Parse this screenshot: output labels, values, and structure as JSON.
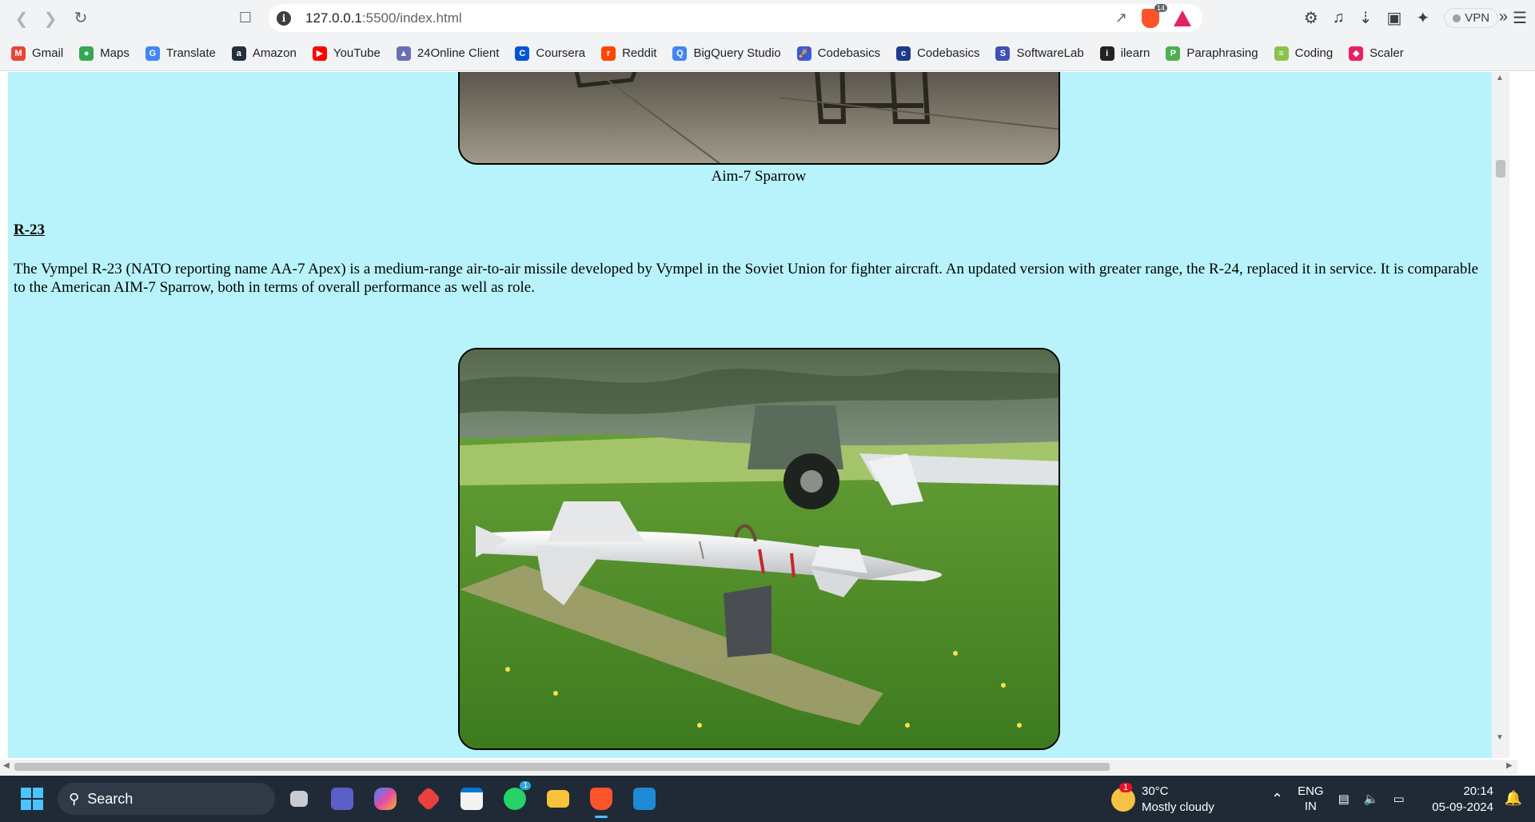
{
  "browser": {
    "url_host": "127.0.0.1",
    "url_path": ":5500/index.html",
    "shield_badge": "14",
    "vpn_label": "VPN"
  },
  "bookmarks": [
    {
      "label": "Gmail",
      "color": "#ea4335",
      "icon": "M"
    },
    {
      "label": "Maps",
      "color": "#34a853",
      "icon": "●"
    },
    {
      "label": "Translate",
      "color": "#4285f4",
      "icon": "G"
    },
    {
      "label": "Amazon",
      "color": "#232f3e",
      "icon": "a"
    },
    {
      "label": "YouTube",
      "color": "#ff0000",
      "icon": "▶"
    },
    {
      "label": "24Online Client",
      "color": "#6a6fb5",
      "icon": "▲"
    },
    {
      "label": "Coursera",
      "color": "#0056d2",
      "icon": "C"
    },
    {
      "label": "Reddit",
      "color": "#ff4500",
      "icon": "r"
    },
    {
      "label": "BigQuery Studio",
      "color": "#4285f4",
      "icon": "Q"
    },
    {
      "label": "Codebasics",
      "color": "#3b5bdb",
      "icon": "🚀"
    },
    {
      "label": "Codebasics",
      "color": "#1e3a8a",
      "icon": "c"
    },
    {
      "label": "SoftwareLab",
      "color": "#3f51b5",
      "icon": "S"
    },
    {
      "label": "ilearn",
      "color": "#222222",
      "icon": "i"
    },
    {
      "label": "Paraphrasing",
      "color": "#4caf50",
      "icon": "P"
    },
    {
      "label": "Coding",
      "color": "#8bc34a",
      "icon": "≡"
    },
    {
      "label": "Scaler",
      "color": "#e91e63",
      "icon": "◆"
    }
  ],
  "page": {
    "caption_top": "Aim-7 Sparrow",
    "section_heading": "R-23",
    "section_text": "The Vympel R-23 (NATO reporting name AA-7 Apex) is a medium-range air-to-air missile developed by Vympel in the Soviet Union for fighter aircraft. An updated version with greater range, the R-24, replaced it in service. It is comparable to the American AIM-7 Sparrow, both in terms of overall performance as well as role.",
    "background_color": "#b8f3fb"
  },
  "taskbar": {
    "search_label": "Search",
    "weather_temp": "30°C",
    "weather_desc": "Mostly cloudy",
    "weather_badge": "1",
    "whatsapp_badge": "1",
    "lang_line1": "ENG",
    "lang_line2": "IN",
    "time": "20:14",
    "date": "05-09-2024"
  }
}
